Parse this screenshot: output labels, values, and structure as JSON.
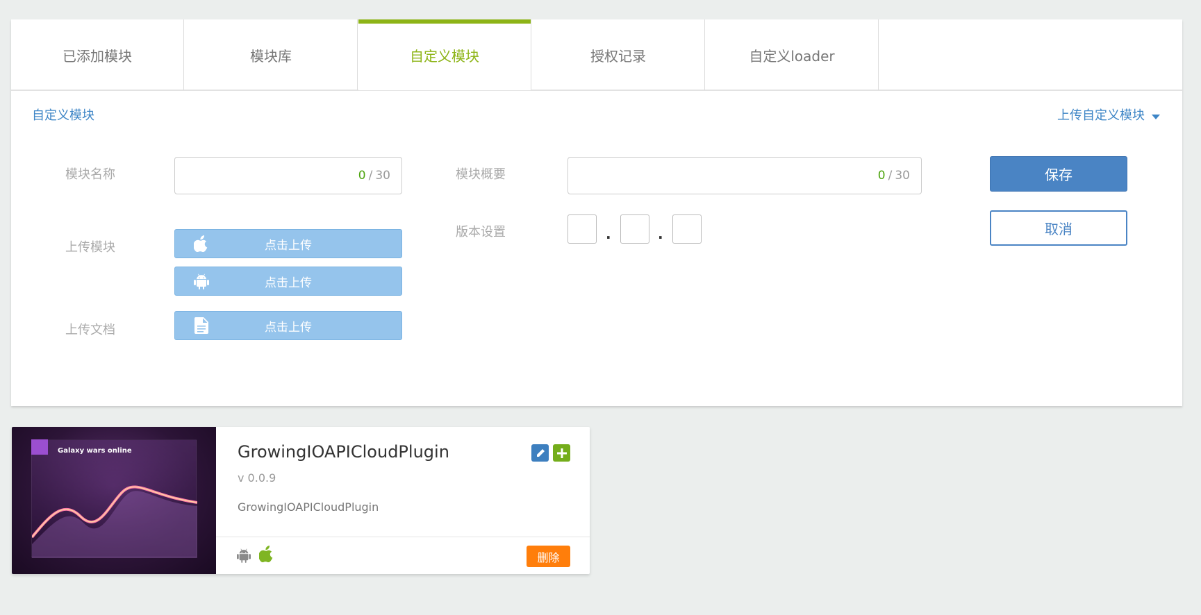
{
  "tabs": [
    {
      "label": "已添加模块",
      "active": false
    },
    {
      "label": "模块库",
      "active": false
    },
    {
      "label": "自定义模块",
      "active": true
    },
    {
      "label": "授权记录",
      "active": false
    },
    {
      "label": "自定义loader",
      "active": false
    }
  ],
  "breadcrumb": "自定义模块",
  "upload_menu": {
    "label": "上传自定义模块",
    "icon": "caret-down-icon"
  },
  "form": {
    "name": {
      "label": "模块名称",
      "value": "",
      "count": "0",
      "sep": "/",
      "max": "30"
    },
    "summary": {
      "label": "模块概要",
      "value": "",
      "count": "0",
      "sep": "/",
      "max": "30"
    },
    "upload_module": {
      "label": "上传模块"
    },
    "upload_ios": {
      "label": "点击上传",
      "icon": "apple-icon"
    },
    "upload_android": {
      "label": "点击上传",
      "icon": "android-icon"
    },
    "upload_doc": {
      "label": "上传文档"
    },
    "upload_doc_btn": {
      "label": "点击上传",
      "icon": "document-icon"
    },
    "version": {
      "label": "版本设置",
      "major": "",
      "minor": "",
      "patch": "",
      "sep": "."
    }
  },
  "actions": {
    "save": "保存",
    "cancel": "取消"
  },
  "colors": {
    "accent_green": "#8db417",
    "link_blue": "#3d85c6",
    "save_blue": "#4a84c4",
    "upload_blue": "#95c4ec",
    "delete_orange": "#ff7e0b"
  },
  "module_card": {
    "thumb_title": "Galaxy wars online",
    "title": "GrowingIOAPICloudPlugin",
    "version": "v 0.0.9",
    "description": "GrowingIOAPICloudPlugin",
    "platforms": [
      "android-icon",
      "apple-icon"
    ],
    "delete_label": "删除"
  }
}
